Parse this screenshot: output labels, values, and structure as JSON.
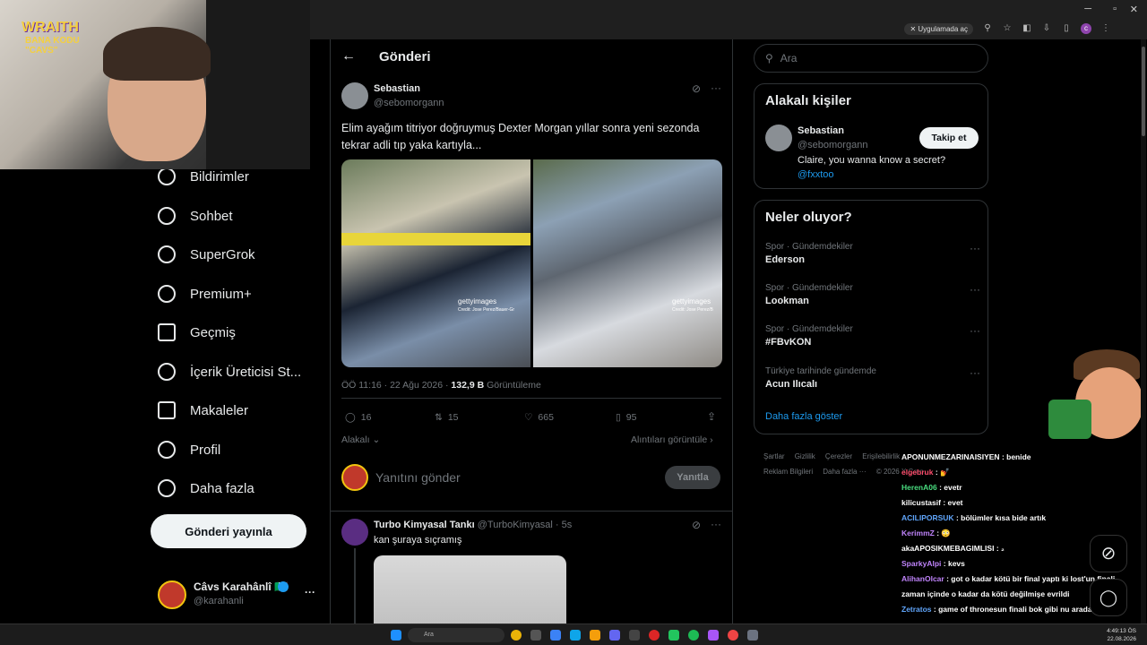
{
  "browser": {
    "open_in_app_label": "Uygulamada aç"
  },
  "overlay": {
    "brand": "WRAITH",
    "brand_sub": "BANA KODU",
    "brand_sub2": "\"CAVS\""
  },
  "nav": {
    "items": [
      {
        "label": "Bildirimler",
        "icon": "bell-icon"
      },
      {
        "label": "Sohbet",
        "icon": "chat-icon"
      },
      {
        "label": "SuperGrok",
        "icon": "grok-icon"
      },
      {
        "label": "Premium+",
        "icon": "verified-icon"
      },
      {
        "label": "Geçmiş",
        "icon": "bookmark-icon"
      },
      {
        "label": "İçerik Üreticisi St...",
        "icon": "rocket-icon"
      },
      {
        "label": "Makaleler",
        "icon": "article-icon"
      },
      {
        "label": "Profil",
        "icon": "person-icon"
      },
      {
        "label": "Daha fazla",
        "icon": "more-circle-icon"
      }
    ],
    "post_button": "Gönderi yayınla",
    "account": {
      "name": "Câvs Karahânlî 🇮🇹",
      "handle": "@karahanli",
      "more": "···"
    }
  },
  "post_page": {
    "header": "Gönderi",
    "author_name": "Sebastian",
    "author_handle": "@sebomorgann",
    "text": "Elim ayağım titriyor doğruymuş Dexter Morgan yıllar sonra yeni sezonda tekrar adli tıp yaka kartıyla...",
    "image1_watermark": "gettyimages",
    "image1_credit": "Credit: Jose Perez/Bauer-Gr",
    "image2_watermark": "gettyimages",
    "image2_credit": "Credit: Jose Perez/B",
    "timestamp": "ÖÖ 11:16 · 22 Ağu 2026 · ",
    "views": "132,9 B",
    "views_label": " Görüntüleme",
    "replies": "16",
    "reposts": "15",
    "likes": "665",
    "bookmarks": "95",
    "sort_label": "Alakalı",
    "quotes_label": "Alıntıları görüntüle",
    "reply_placeholder": "Yanıtını gönder",
    "reply_button": "Yanıtla",
    "reply": {
      "author_name": "Turbo Kimyasal Tankı",
      "author_handle": "@TurboKimyasal · 5s",
      "text": "kan şuraya sıçramış"
    }
  },
  "right": {
    "search_placeholder": "Ara",
    "relevant_title": "Alakalı kişiler",
    "person": {
      "name": "Sebastian",
      "handle": "@sebomorgann",
      "bio": "Claire, you wanna know a secret?",
      "bio_link": "@fxxtoo",
      "follow": "Takip et"
    },
    "trends_title": "Neler oluyor?",
    "trends": [
      {
        "category": "Spor · Gündemdekiler",
        "name": "Ederson"
      },
      {
        "category": "Spor · Gündemdekiler",
        "name": "Lookman"
      },
      {
        "category": "Spor · Gündemdekiler",
        "name": "#FBvKON"
      },
      {
        "category": "Türkiye tarihinde gündemde",
        "name": "Acun Ilıcalı"
      }
    ],
    "show_more": "Daha fazla göster",
    "footer": [
      "Şartlar",
      "Gizlilik",
      "Çerezler",
      "Erişilebilirlik",
      "Reklam Bilgileri",
      "Daha fazla ···",
      "© 2026 X Corp."
    ]
  },
  "chat": [
    {
      "user": "APONUNMEZARINAISIYEN",
      "color": "#ffffff",
      "msg": ": benide"
    },
    {
      "user": "elgebruk",
      "color": "#ff4d6d",
      "msg": ": 💅"
    },
    {
      "user": "HerenA06",
      "color": "#4ade80",
      "msg": ": evetr"
    },
    {
      "user": "kilicustasif",
      "color": "#ffffff",
      "msg": ": evet"
    },
    {
      "user": "ACILIPORSUK",
      "color": "#60a5fa",
      "msg": ": bölümler kısa bide artık"
    },
    {
      "user": "KerimmZ",
      "color": "#c084fc",
      "msg": ": 😳"
    },
    {
      "user": "akaAPOSIKMEBAGIMLISI",
      "color": "#ffffff",
      "msg": ": ₂"
    },
    {
      "user": "SparkyAlpi",
      "color": "#c084fc",
      "msg": ": kevs"
    },
    {
      "user": "AlihanOlcar",
      "color": "#c084fc",
      "msg": ": got o kadar kötü bir final yaptı ki lost'un finali"
    },
    {
      "user": "",
      "color": "#ffffff",
      "msg": "zaman içinde o kadar da kötü değilmişe evrildi"
    },
    {
      "user": "Zetratos",
      "color": "#60a5fa",
      "msg": ": game of thronesun finali bok gibi nu arada"
    }
  ],
  "taskbar": {
    "search": "Ara",
    "time": "4:49:13 ÖS",
    "date": "22.08.2026"
  }
}
